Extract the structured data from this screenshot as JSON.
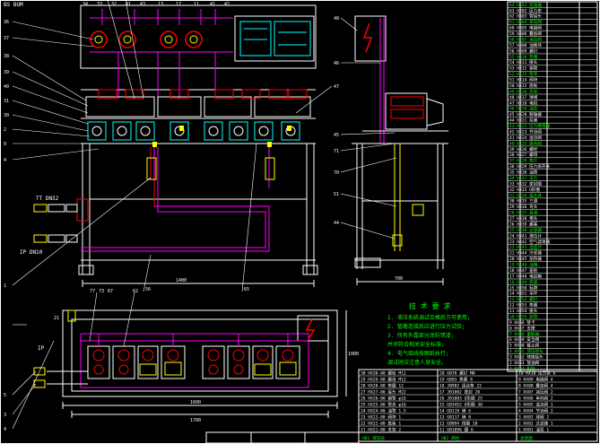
{
  "corner_label": "BS BOM",
  "front_view": {
    "callouts_top": [
      "34",
      "33",
      "32",
      "41",
      "43",
      "13",
      "17",
      "11",
      "41",
      "42",
      "20"
    ],
    "callouts_left": [
      "36",
      "37",
      "38",
      "39",
      "40",
      "31",
      "30",
      "2",
      "9",
      "4",
      "1"
    ],
    "width_dim": "1400",
    "pipe_labels": [
      "TT DN32",
      "IP DN10"
    ]
  },
  "side_view": {
    "callouts": [
      "47",
      "46",
      "45",
      "44",
      "43",
      "51",
      "71",
      "70",
      "48"
    ],
    "width_dim": "700"
  },
  "plan_view": {
    "top_callouts": [
      "77",
      "73",
      "67",
      "62",
      "43",
      "21"
    ],
    "left_callouts": [
      "IP",
      "IT"
    ],
    "width_dim_inner": "1600",
    "width_dim_outer": "1700",
    "height_dim": "1000"
  },
  "notes": {
    "title": "技 术 要 求",
    "lines": [
      "1. 液压系统调试合格后方可使用;",
      "2. 管路连接后应进行压力试验;",
      "3. 所有外露部分涂防锈漆;",
      "   并须符合相关安全标准;",
      "4. 电气接线按图纸执行;",
      "   调试时应注意人身安全。"
    ]
  },
  "parts_list_right": {
    "rows": [
      "64 HX01 滤油器",
      "63 HX02 压力表",
      "62 HX03 管接头",
      "61 HX04 单向阀",
      "60 HX05 电磁阀",
      "59 HX06 叠加阀",
      "58 HX07 减压阀",
      "57 HX08 油路块",
      "56 HX09 螺钉",
      "55 HX10 垫圈",
      "54 HX11 接头",
      "53 HX12 钢管",
      "52 HX13 管夹",
      "51 HX14 阀块",
      "50 HX15 底板",
      "49 HX16 支架",
      "48 HX17 球阀",
      "47 HX18 电机",
      "46 HX19 油泵",
      "45 HX20 联轴器",
      "44 HX21 泵座",
      "43 HX22 压力继电器",
      "42 HX23 节流阀",
      "41 HX24 溢流阀",
      "40 HX25 换向阀",
      "39 HX26 螺栓",
      "38 HX27 螺母",
      "37 HX28 垫片",
      "36 HX29 压力表开关",
      "35 HX30 油管",
      "34 HX31 法兰",
      "33 HX32 密封圈",
      "32 HX33 O形圈",
      "31 HX34 接头体",
      "30 HX35 三通",
      "29 HX36 弯头",
      "28 HX37 直通",
      "27 HX38 堵头",
      "26 HX39 螺塞",
      "25 HX40 过滤器",
      "24 HX41 液位计",
      "23 HX42 空气滤清器",
      "22 HX43 温度计",
      "21 HX44 冷却器",
      "20 HX45 加热器",
      "19 HX46 油箱",
      "18 HX47 盖板",
      "17 HX48 电控箱",
      "16 HX49 底座",
      "15 HX50 标牌",
      "14 HX51 吊环",
      "13 HX52 螺钉",
      "12 HX53 垫圈",
      "11 HX54 接头",
      "10 HX55 软管",
      "9 HX56 管卡",
      "8 HX57 支撑",
      "7 HX58 蓄能器",
      "6 HX59 安全阀",
      "5 HX60 截止阀",
      "4 HX61 测压接头",
      "3 HX62 快换接头",
      "2 HX63 放油阀",
      "1 HX64 机架"
    ]
  },
  "parts_list_bottom": {
    "rows": [
      "30 HX30-00 螺栓 M12",
      "29 HX29-00 螺母 M12",
      "28 HX28-00 垫圈 12",
      "27 HX27-00 接头 M22",
      "26 HX26-00 钢管 φ16",
      "25 HX25-00 管夹 φ16",
      "24 HX24-00 油管 1.5",
      "23 HX23-00 阀块 1",
      "22 HX22-00 底板 1",
      "21 HX21-00 支架 2"
    ],
    "rows_col2": [
      "20 GB70 螺钉 M8",
      "19 GB93 垫圈 8",
      "18 JB982 组合垫 22",
      "17 JB1002 密封 20",
      "16 JB1003 O形圈 25",
      "15 GB3452 O形圈 30",
      "14 GB119 销 6",
      "13 GB117 销 8",
      "12 GB894 挡圈 20",
      "11 GB1096 键 6"
    ],
    "rows_col3": [
      "10 HX10 压力表 6",
      "9 HX09 电磁阀 4",
      "8 HX08 叠加阀 4",
      "7 HX07 减压阀 2",
      "6 HX06 单向阀 2",
      "5 HX05 溢流阀 1",
      "4 HX04 节流阀 2",
      "3 HX03 球阀 2",
      "2 HX02 过滤器 1",
      "1 HX01 油泵 1"
    ],
    "footer": [
      "HB1 液压站",
      "HB2 阀台",
      "总装图"
    ]
  },
  "colors": {
    "background": "#000000",
    "frame": "#ffffff",
    "yellow": "#ffff00",
    "cyan": "#00ffff",
    "magenta": "#ff00ff",
    "red": "#ff0000",
    "green": "#00ff00"
  }
}
